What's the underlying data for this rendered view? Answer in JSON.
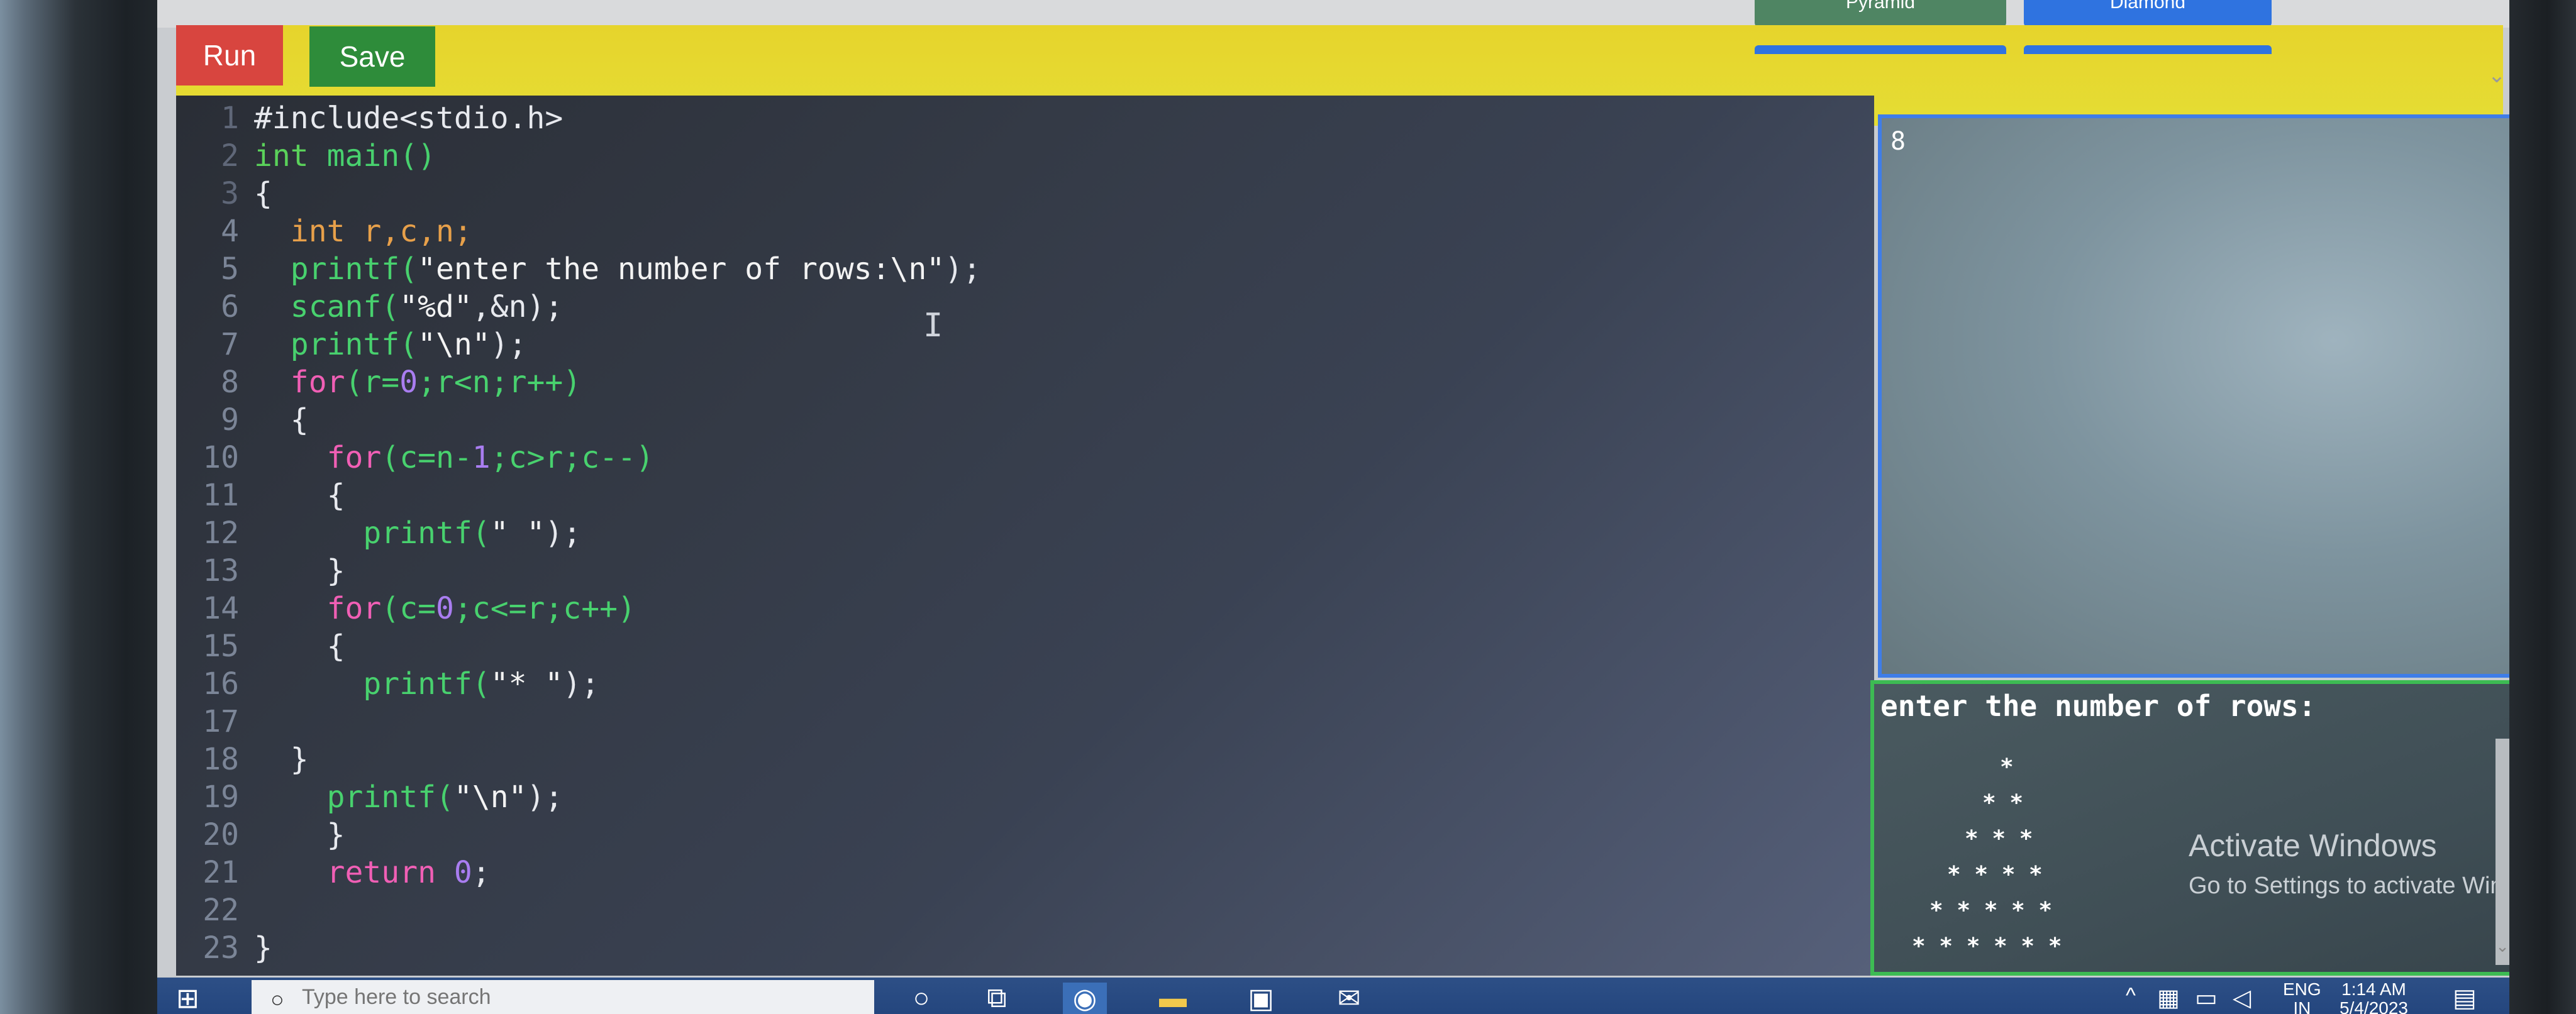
{
  "toolbar": {
    "run_label": "Run",
    "save_label": "Save",
    "top_buttons": [
      {
        "label": "Pyramid",
        "color": "#4f8563"
      },
      {
        "label": "Diamond",
        "color": "#2f73e0"
      }
    ]
  },
  "editor": {
    "lines": [
      {
        "n": "1",
        "tokens": [
          {
            "t": "#include<stdio.h>",
            "c": "pre"
          }
        ]
      },
      {
        "n": "2",
        "tokens": [
          {
            "t": "int",
            "c": "typ"
          },
          {
            "t": " main()",
            "c": "fn"
          }
        ]
      },
      {
        "n": "3",
        "tokens": [
          {
            "t": "{",
            "c": "plain"
          }
        ]
      },
      {
        "n": "4",
        "tokens": [
          {
            "t": "  ",
            "c": "plain"
          },
          {
            "t": "int",
            "c": "var"
          },
          {
            "t": " r,c,n;",
            "c": "var"
          }
        ]
      },
      {
        "n": "5",
        "tokens": [
          {
            "t": "  printf(",
            "c": "fn"
          },
          {
            "t": "\"enter the number of rows:\\n\"",
            "c": "str"
          },
          {
            "t": ");",
            "c": "plain"
          }
        ]
      },
      {
        "n": "6",
        "tokens": [
          {
            "t": "  scanf(",
            "c": "fn"
          },
          {
            "t": "\"%d\"",
            "c": "str"
          },
          {
            "t": ",&n);",
            "c": "plain"
          }
        ]
      },
      {
        "n": "7",
        "tokens": [
          {
            "t": "  printf(",
            "c": "fn"
          },
          {
            "t": "\"\\n\"",
            "c": "str"
          },
          {
            "t": ");",
            "c": "plain"
          }
        ]
      },
      {
        "n": "8",
        "tokens": [
          {
            "t": "  for",
            "c": "key"
          },
          {
            "t": "(r=",
            "c": "fn"
          },
          {
            "t": "0",
            "c": "num"
          },
          {
            "t": ";r<n;r++)",
            "c": "fn"
          }
        ]
      },
      {
        "n": "9",
        "tokens": [
          {
            "t": "  {",
            "c": "plain"
          }
        ]
      },
      {
        "n": "10",
        "tokens": [
          {
            "t": "    for",
            "c": "key"
          },
          {
            "t": "(c=n-",
            "c": "fn"
          },
          {
            "t": "1",
            "c": "num"
          },
          {
            "t": ";c>r;c--)",
            "c": "fn"
          }
        ]
      },
      {
        "n": "11",
        "tokens": [
          {
            "t": "    {",
            "c": "plain"
          }
        ]
      },
      {
        "n": "12",
        "tokens": [
          {
            "t": "      printf(",
            "c": "fn"
          },
          {
            "t": "\" \"",
            "c": "str"
          },
          {
            "t": ");",
            "c": "plain"
          }
        ]
      },
      {
        "n": "13",
        "tokens": [
          {
            "t": "    }",
            "c": "plain"
          }
        ]
      },
      {
        "n": "14",
        "tokens": [
          {
            "t": "    for",
            "c": "key"
          },
          {
            "t": "(c=",
            "c": "fn"
          },
          {
            "t": "0",
            "c": "num"
          },
          {
            "t": ";c<=r;c++)",
            "c": "fn"
          }
        ]
      },
      {
        "n": "15",
        "tokens": [
          {
            "t": "    {",
            "c": "plain"
          }
        ]
      },
      {
        "n": "16",
        "tokens": [
          {
            "t": "      printf(",
            "c": "fn"
          },
          {
            "t": "\"* \"",
            "c": "str"
          },
          {
            "t": ");",
            "c": "plain"
          }
        ]
      },
      {
        "n": "17",
        "tokens": []
      },
      {
        "n": "18",
        "tokens": [
          {
            "t": "  }",
            "c": "plain"
          }
        ]
      },
      {
        "n": "19",
        "tokens": [
          {
            "t": "    printf(",
            "c": "fn"
          },
          {
            "t": "\"\\n\"",
            "c": "str"
          },
          {
            "t": ");",
            "c": "plain"
          }
        ]
      },
      {
        "n": "20",
        "tokens": [
          {
            "t": "    }",
            "c": "plain"
          }
        ]
      },
      {
        "n": "21",
        "tokens": [
          {
            "t": "    return",
            "c": "key"
          },
          {
            "t": " ",
            "c": "plain"
          },
          {
            "t": "0",
            "c": "num"
          },
          {
            "t": ";",
            "c": "plain"
          }
        ]
      },
      {
        "n": "22",
        "tokens": []
      },
      {
        "n": "23",
        "tokens": [
          {
            "t": "}",
            "c": "plain"
          }
        ]
      }
    ]
  },
  "input_panel": {
    "value": "8"
  },
  "output_panel": {
    "prompt": "enter the number of rows:",
    "rows": [
      "*",
      "* *",
      "* * *",
      "* * * *",
      "* * * * *",
      "* * * * * *"
    ]
  },
  "watermark": {
    "title": "Activate Windows",
    "subtitle": "Go to Settings to activate Windows."
  },
  "taskbar": {
    "search_placeholder": "Type here to search",
    "language_line1": "ENG",
    "language_line2": "IN",
    "time": "1:14 AM",
    "date": "5/4/2023"
  },
  "colors": {
    "toolbar": "#e6d42c",
    "run": "#d8453f",
    "save": "#2e8c3a",
    "input_border": "#3f7de8",
    "output_border": "#3dbb53"
  }
}
